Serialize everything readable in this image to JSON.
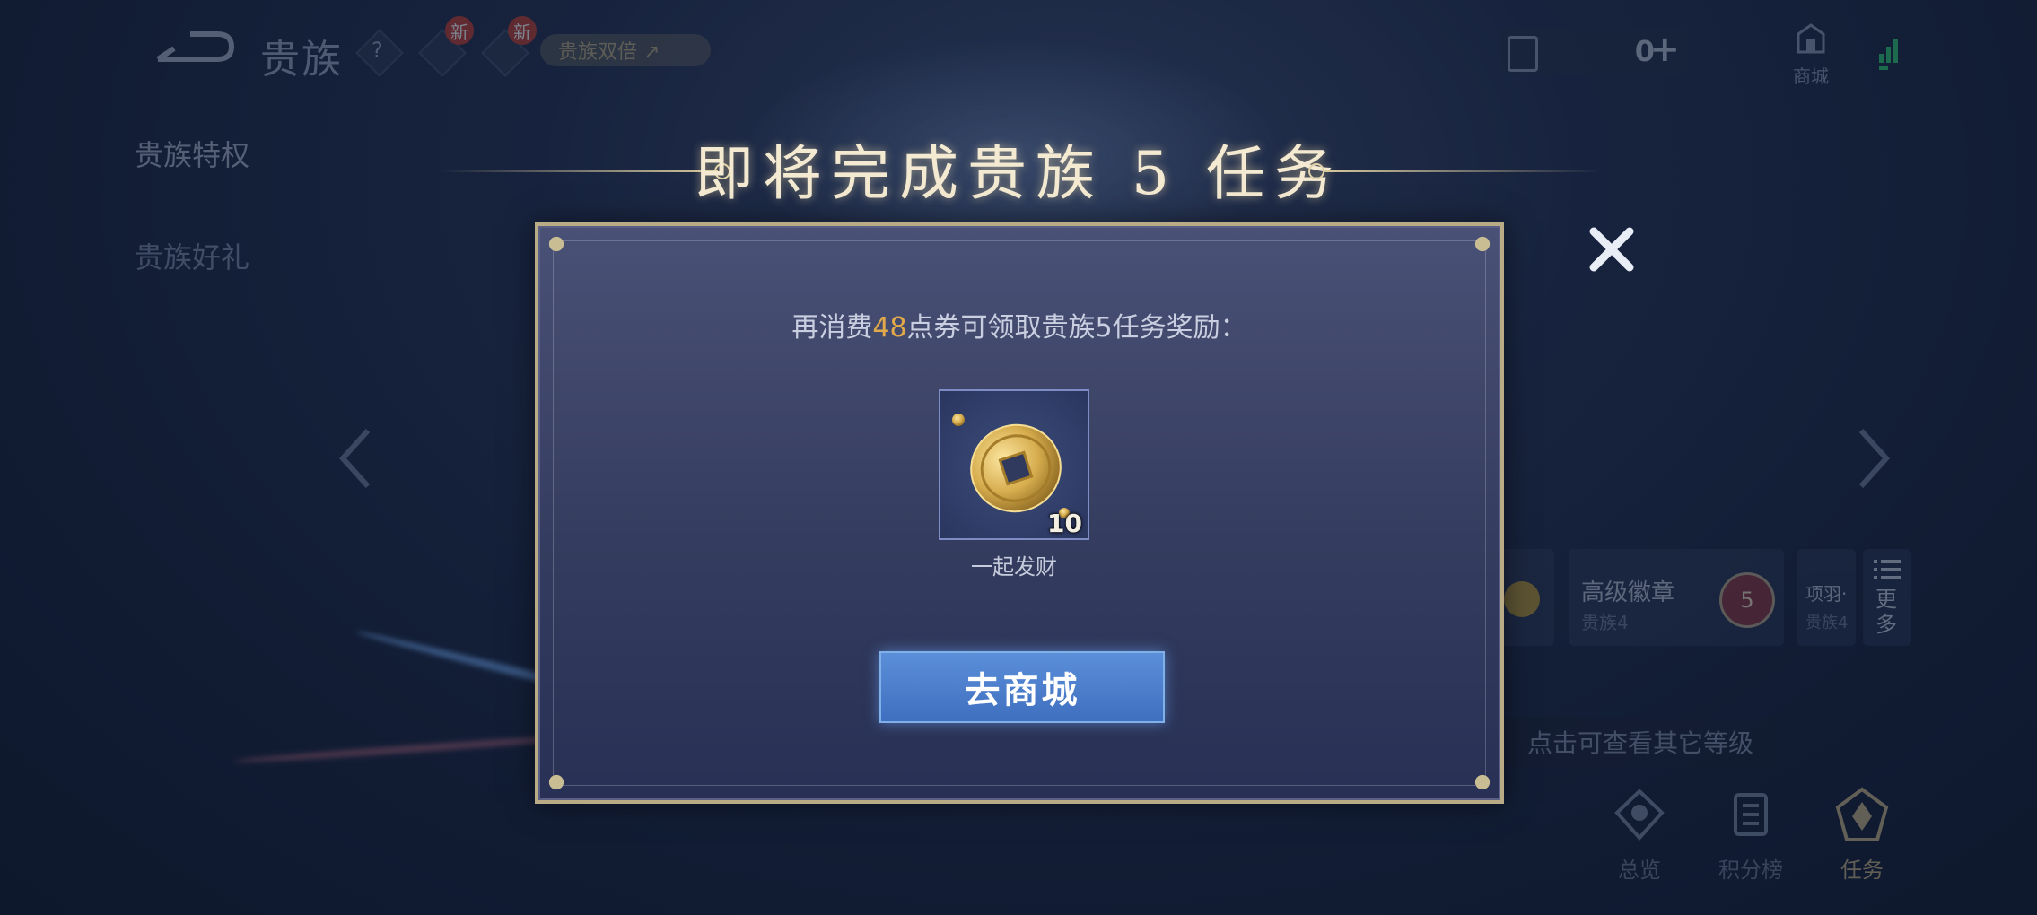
{
  "top_bar": {
    "title": "贵族",
    "help_icon": "question-icon",
    "new_badge_1": "新",
    "new_badge_2": "新",
    "pill_label": "贵族双倍 ↗",
    "currency_value": "0",
    "currency_add": "+",
    "shop_label": "商城"
  },
  "sidebar": {
    "items": [
      {
        "label": "贵族特权"
      },
      {
        "label": "贵族好礼"
      }
    ]
  },
  "modal": {
    "heading": "即将完成贵族 5 任务",
    "info_prefix": "再消费",
    "info_amount": "48",
    "info_suffix": "点券可领取贵族5任务奖励：",
    "reward": {
      "name": "一起发财",
      "count": "10",
      "icon": "gold-coin-icon"
    },
    "go_shop_label": "去商城",
    "close_icon": "close-icon"
  },
  "background_panel": {
    "badge_title": "高级徽章",
    "badge_sub": "贵族4",
    "badge_level": "5",
    "next_title": "项羽·",
    "next_sub": "贵族4",
    "more_label": "更多",
    "hint": "点击可查看其它等级",
    "tabs": [
      {
        "label": "总览"
      },
      {
        "label": "积分榜"
      },
      {
        "label": "任务"
      }
    ]
  },
  "colors": {
    "highlight": "#e2a94a",
    "button": "#4a7fcf",
    "frame": "#b8ab85"
  }
}
